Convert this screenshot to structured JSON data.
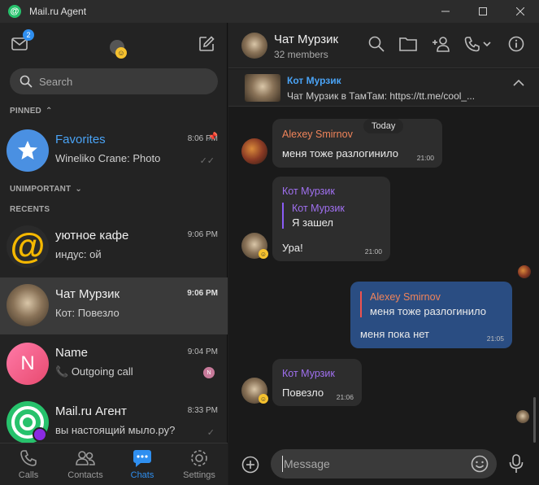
{
  "window": {
    "title": "Mail.ru Agent"
  },
  "sidebar": {
    "mail_badge": "2",
    "search": {
      "placeholder": "Search"
    },
    "sections": {
      "pinned": "PINNED",
      "unimportant": "UNIMPORTANT",
      "recents": "RECENTS"
    },
    "chats": [
      {
        "name": "Favorites",
        "preview": "Wineliko Crane: Photo",
        "time": "8:06 PM"
      },
      {
        "name": "уютное кафе",
        "preview_sender": "индус:",
        "preview": " ой",
        "time": "9:06 PM"
      },
      {
        "name": "Чат Мурзик",
        "preview": "Кот: Повезло",
        "time": "9:06 PM"
      },
      {
        "name": "Name",
        "preview": "Outgoing call",
        "time": "9:04 PM",
        "initial": "N"
      },
      {
        "name": "Mail.ru Агент",
        "preview": "вы настоящий мыло.ру?",
        "time": "8:33 PM"
      }
    ],
    "nav": {
      "calls": "Calls",
      "contacts": "Contacts",
      "chats": "Chats",
      "settings": "Settings"
    }
  },
  "chat": {
    "title": "Чат Мурзик",
    "members": "32 members",
    "pinned": {
      "name": "Кот Мурзик",
      "text": "Чат Мурзик в ТамТам: https://tt.me/cool_..."
    },
    "date": "Today",
    "messages": [
      {
        "sender": "Alexey Smirnov",
        "text": "меня тоже разлогинило",
        "time": "21:00"
      },
      {
        "sender": "Кот Мурзик",
        "quote_name": "Кот Мурзик",
        "quote_text": "Я зашел",
        "text": "Ура!",
        "time": "21:00"
      },
      {
        "quote_name": "Alexey Smirnov",
        "quote_text": "меня тоже разлогинило",
        "text": "меня пока нет",
        "time": "21:05"
      },
      {
        "sender": "Кот Мурзик",
        "text": "Повезло",
        "time": "21:06"
      }
    ],
    "composer": {
      "placeholder": "Message"
    }
  },
  "colors": {
    "accent": "#2f8ff0",
    "outgoing_bubble": "#2a4d82",
    "sender_orange": "#f0845a",
    "sender_purple": "#a070f0"
  }
}
